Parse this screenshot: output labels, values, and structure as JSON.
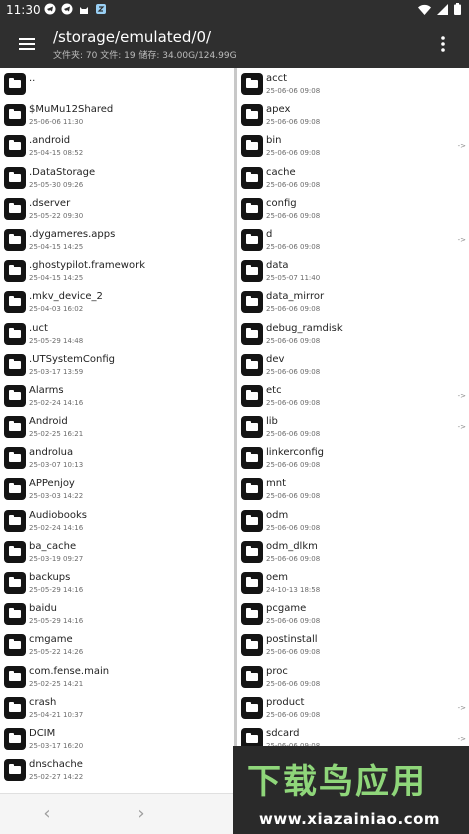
{
  "status_bar": {
    "time": "11:30",
    "icons": [
      "telegram-icon",
      "telegram-icon",
      "cat-icon",
      "app-icon"
    ],
    "right_icons": [
      "wifi-icon",
      "signal-icon",
      "battery-icon"
    ]
  },
  "app_bar": {
    "title": "/storage/emulated/0/",
    "subtitle": "文件夹: 70  文件: 19  储存: 34.00G/124.99G"
  },
  "left_pane": [
    {
      "name": "..",
      "date": ""
    },
    {
      "name": "$MuMu12Shared",
      "date": "25-06-06 11:30"
    },
    {
      "name": ".android",
      "date": "25-04-15 08:52"
    },
    {
      "name": ".DataStorage",
      "date": "25-05-30 09:26"
    },
    {
      "name": ".dserver",
      "date": "25-05-22 09:30"
    },
    {
      "name": ".dygameres.apps",
      "date": "25-04-15 14:25"
    },
    {
      "name": ".ghostypilot.framework",
      "date": "25-04-15 14:25"
    },
    {
      "name": ".mkv_device_2",
      "date": "25-04-03 16:02"
    },
    {
      "name": ".uct",
      "date": "25-05-29 14:48"
    },
    {
      "name": ".UTSystemConfig",
      "date": "25-03-17 13:59"
    },
    {
      "name": "Alarms",
      "date": "25-02-24 14:16"
    },
    {
      "name": "Android",
      "date": "25-02-25 16:21"
    },
    {
      "name": "androlua",
      "date": "25-03-07 10:13"
    },
    {
      "name": "APPenjoy",
      "date": "25-03-03 14:22"
    },
    {
      "name": "Audiobooks",
      "date": "25-02-24 14:16"
    },
    {
      "name": "ba_cache",
      "date": "25-03-19 09:27"
    },
    {
      "name": "backups",
      "date": "25-05-29 14:16"
    },
    {
      "name": "baidu",
      "date": "25-05-29 14:16"
    },
    {
      "name": "cmgame",
      "date": "25-05-22 14:26"
    },
    {
      "name": "com.fense.main",
      "date": "25-02-25 14:21"
    },
    {
      "name": "crash",
      "date": "25-04-21 10:37"
    },
    {
      "name": "DCIM",
      "date": "25-03-17 16:20"
    },
    {
      "name": "dnschache",
      "date": "25-02-27 14:22"
    }
  ],
  "right_pane": [
    {
      "name": "acct",
      "date": "25-06-06 09:08",
      "link": ""
    },
    {
      "name": "apex",
      "date": "25-06-06 09:08",
      "link": ""
    },
    {
      "name": "bin",
      "date": "25-06-06 09:08",
      "link": "->"
    },
    {
      "name": "cache",
      "date": "25-06-06 09:08",
      "link": ""
    },
    {
      "name": "config",
      "date": "25-06-06 09:08",
      "link": ""
    },
    {
      "name": "d",
      "date": "25-06-06 09:08",
      "link": "->"
    },
    {
      "name": "data",
      "date": "25-05-07 11:40",
      "link": ""
    },
    {
      "name": "data_mirror",
      "date": "25-06-06 09:08",
      "link": ""
    },
    {
      "name": "debug_ramdisk",
      "date": "25-06-06 09:08",
      "link": ""
    },
    {
      "name": "dev",
      "date": "25-06-06 09:08",
      "link": ""
    },
    {
      "name": "etc",
      "date": "25-06-06 09:08",
      "link": "->"
    },
    {
      "name": "lib",
      "date": "25-06-06 09:08",
      "link": "->"
    },
    {
      "name": "linkerconfig",
      "date": "25-06-06 09:08",
      "link": ""
    },
    {
      "name": "mnt",
      "date": "25-06-06 09:08",
      "link": ""
    },
    {
      "name": "odm",
      "date": "25-06-06 09:08",
      "link": ""
    },
    {
      "name": "odm_dlkm",
      "date": "25-06-06 09:08",
      "link": ""
    },
    {
      "name": "oem",
      "date": "24-10-13 18:58",
      "link": ""
    },
    {
      "name": "pcgame",
      "date": "25-06-06 09:08",
      "link": ""
    },
    {
      "name": "postinstall",
      "date": "25-06-06 09:08",
      "link": ""
    },
    {
      "name": "proc",
      "date": "25-06-06 09:08",
      "link": ""
    },
    {
      "name": "product",
      "date": "25-06-06 09:08",
      "link": "->"
    },
    {
      "name": "sdcard",
      "date": "25-06-06 09:08",
      "link": "->"
    }
  ],
  "bottom_bar": {
    "back": "‹",
    "forward": "›"
  },
  "watermark": {
    "title": "下载鸟应用",
    "url": "www.xiazainiao.com"
  }
}
